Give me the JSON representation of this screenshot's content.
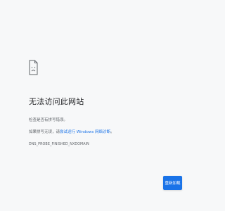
{
  "error": {
    "icon": "sad-page-icon",
    "title": "无法访问此网站",
    "check_text": "检查是否有拼写错误。",
    "suggest_prefix": "如果拼写无误，请",
    "suggest_link": "尝试运行 Windows 网络诊断",
    "suggest_suffix": "。",
    "code": "DNS_PROBE_FINISHED_NXDOMAIN"
  },
  "actions": {
    "reload_label": "重新加载"
  },
  "colors": {
    "background": "#f7f8f9",
    "accent": "#1a73e8",
    "title": "#202124",
    "text": "#5f6368"
  }
}
